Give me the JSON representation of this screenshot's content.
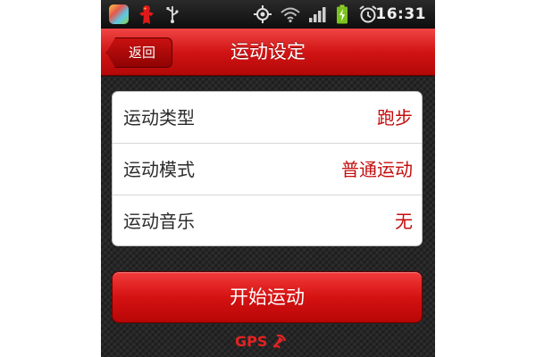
{
  "status_bar": {
    "clock": "16:31",
    "left_icons": [
      "colorful-app-icon",
      "red-figure-app-icon",
      "usb-icon"
    ],
    "right_icons": [
      "gps-location-icon",
      "wifi-icon",
      "signal-bars-icon",
      "battery-charging-icon",
      "alarm-clock-icon"
    ]
  },
  "header": {
    "back_label": "返回",
    "title": "运动设定"
  },
  "settings": {
    "rows": [
      {
        "label": "运动类型",
        "value": "跑步"
      },
      {
        "label": "运动模式",
        "value": "普通运动"
      },
      {
        "label": "运动音乐",
        "value": "无"
      }
    ]
  },
  "actions": {
    "start_label": "开始运动"
  },
  "gps": {
    "label": "GPS",
    "icon": "gps-signal-icon"
  },
  "colors": {
    "accent_red": "#d11414",
    "value_red": "#c30d0d",
    "gps_red": "#e52222",
    "background_dark": "#262626"
  }
}
